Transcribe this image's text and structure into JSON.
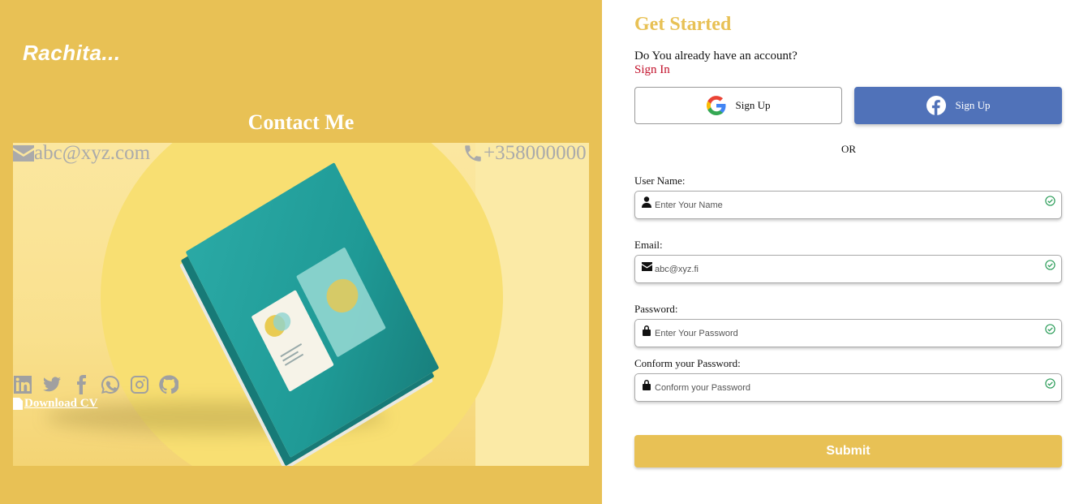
{
  "brand": {
    "logo_text": "Rachita..."
  },
  "contact": {
    "title": "Contact Me",
    "email": "abc@xyz.com",
    "phone": "+358000000",
    "socials": [
      "linkedin-icon",
      "twitter-icon",
      "facebook-icon",
      "whatsapp-icon",
      "instagram-icon",
      "github-icon"
    ],
    "download_label": "Download CV"
  },
  "form": {
    "title": "Get Started",
    "question": "Do You already have an account?",
    "signin_label": "Sign In",
    "google_label": "Sign Up",
    "facebook_label": "Sign Up",
    "or_label": "OR",
    "username_label": "User Name:",
    "username_placeholder": "Enter Your Name",
    "email_label": "Email:",
    "email_placeholder": "abc@xyz.fi",
    "password_label": "Password:",
    "password_placeholder": "Enter Your Password",
    "confirm_label": "Conform your Password:",
    "confirm_placeholder": "Conform your Password",
    "submit_label": "Submit"
  },
  "colors": {
    "accent": "#e8c155",
    "facebook": "#5072b9",
    "signin": "#c2102a",
    "valid": "#2e9e5b"
  }
}
